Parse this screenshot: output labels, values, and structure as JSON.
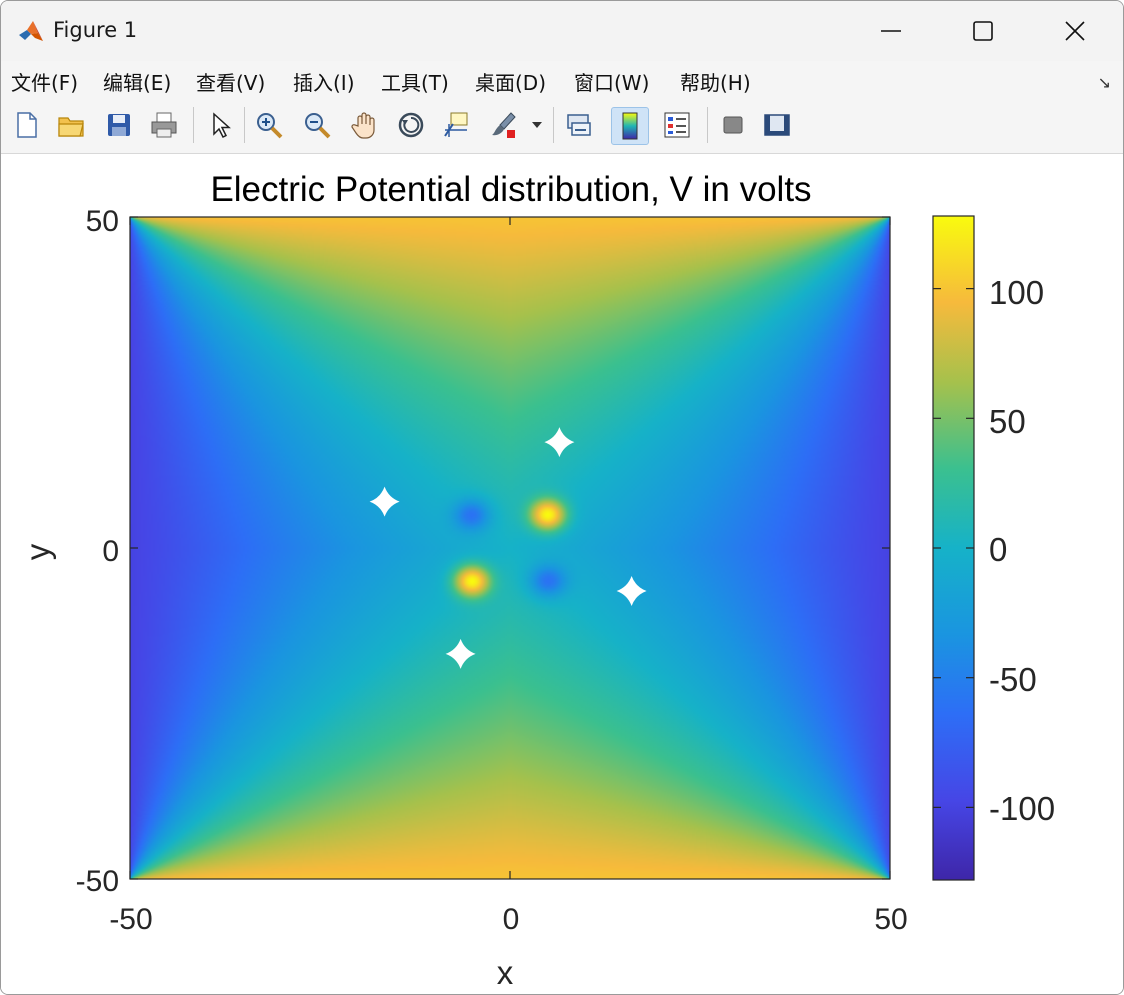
{
  "window": {
    "title": "Figure 1"
  },
  "menu": {
    "items": [
      "文件(F)",
      "编辑(E)",
      "查看(V)",
      "插入(I)",
      "工具(T)",
      "桌面(D)",
      "窗口(W)",
      "帮助(H)"
    ]
  },
  "toolbar": {
    "icons": [
      "new-figure-icon",
      "open-icon",
      "save-icon",
      "print-icon",
      "pointer-icon",
      "zoom-in-icon",
      "zoom-out-icon",
      "pan-icon",
      "rotate-3d-icon",
      "data-cursor-icon",
      "brush-icon",
      "brush-dropdown-icon",
      "link-plot-icon",
      "colorbar-icon",
      "legend-icon",
      "hide-plot-tools-icon",
      "show-plot-tools-icon"
    ],
    "active": "colorbar-icon"
  },
  "chart_data": {
    "type": "heatmap",
    "title": "Electric Potential distribution, V in volts",
    "xlabel": "x",
    "ylabel": "y",
    "xlim": [
      -50,
      50
    ],
    "ylim": [
      -50,
      50
    ],
    "x_ticks": [
      "-50",
      "0",
      "50"
    ],
    "y_ticks": [
      "50",
      "0",
      "-50"
    ],
    "colorbar": {
      "colormap": "parula",
      "clim": [
        -128,
        128
      ],
      "ticks": [
        "100",
        "50",
        "0",
        "-50",
        "-100"
      ],
      "tick_values": [
        100,
        50,
        0,
        -50,
        -100
      ]
    },
    "boundary_potential": {
      "top_edge": 100,
      "bottom_edge": 100,
      "left_edge": -100,
      "right_edge": -100
    },
    "point_charges": [
      {
        "x": 5,
        "y": 5,
        "potential": 128
      },
      {
        "x": -5,
        "y": -5,
        "potential": 128
      },
      {
        "x": -5,
        "y": 5,
        "potential": -60
      },
      {
        "x": 5,
        "y": -5,
        "potential": -60
      }
    ],
    "colors": {
      "axes_background": "#ffffff",
      "axis_color": "#262626"
    }
  }
}
